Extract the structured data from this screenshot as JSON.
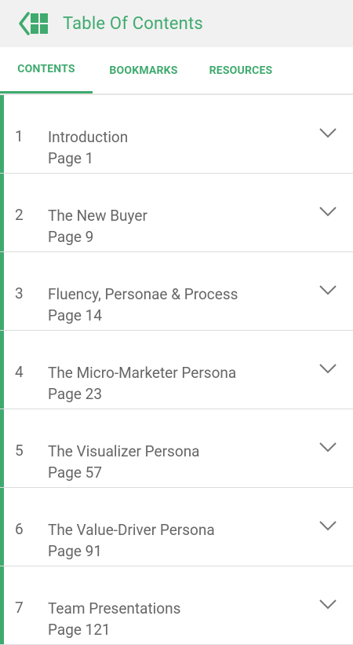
{
  "appbar": {
    "title": "Table Of Contents",
    "back_icon": "back-grid-icon"
  },
  "tabs": [
    {
      "label": "CONTENTS",
      "active": true
    },
    {
      "label": "BOOKMARKS",
      "active": false
    },
    {
      "label": "RESOURCES",
      "active": false
    }
  ],
  "toc": [
    {
      "num": "1",
      "title": "Introduction",
      "page": "Page 1"
    },
    {
      "num": "2",
      "title": "The New Buyer",
      "page": "Page 9"
    },
    {
      "num": "3",
      "title": "Fluency, Personae & Process",
      "page": "Page 14"
    },
    {
      "num": "4",
      "title": "The Micro-Marketer Persona",
      "page": "Page 23"
    },
    {
      "num": "5",
      "title": "The Visualizer Persona",
      "page": "Page 57"
    },
    {
      "num": "6",
      "title": "The Value-Driver Persona",
      "page": "Page 91"
    },
    {
      "num": "7",
      "title": "Team Presentations",
      "page": "Page 121"
    }
  ],
  "colors": {
    "accent": "#3faa6e",
    "appbar_bg": "#f1f1f1"
  }
}
